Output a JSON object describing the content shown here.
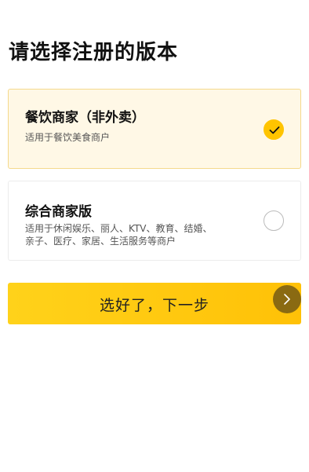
{
  "page": {
    "title": "请选择注册的版本"
  },
  "options": [
    {
      "title": "餐饮商家（非外卖）",
      "desc_lines": [
        "适用于餐饮美食商户"
      ],
      "selected": true
    },
    {
      "title": "综合商家版",
      "desc_lines": [
        "适用于休闲娱乐、丽人、KTV、教育、结婚、",
        "亲子、医疗、家居、生活服务等商户"
      ],
      "selected": false
    }
  ],
  "next_button": {
    "label": "选好了，下一步"
  },
  "colors": {
    "accent": "#ffc400",
    "selected_bg": "#fff8e6",
    "arrow_circle": "#8a6a12"
  },
  "icons": {
    "check": "check-icon",
    "arrow": "chevron-right-icon"
  }
}
